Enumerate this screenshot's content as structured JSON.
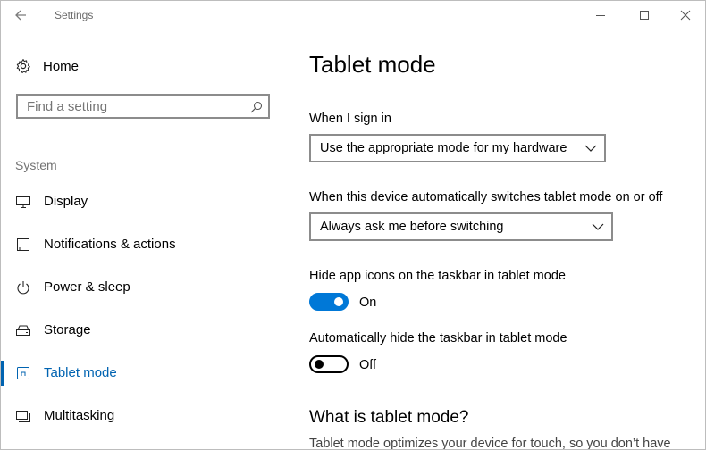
{
  "window": {
    "title": "Settings"
  },
  "sidebar": {
    "home_label": "Home",
    "search_placeholder": "Find a setting",
    "section_label": "System",
    "items": [
      {
        "label": "Display",
        "icon": "monitor-icon"
      },
      {
        "label": "Notifications & actions",
        "icon": "notification-icon"
      },
      {
        "label": "Power & sleep",
        "icon": "power-icon"
      },
      {
        "label": "Storage",
        "icon": "storage-icon"
      },
      {
        "label": "Tablet mode",
        "icon": "tablet-icon",
        "active": true
      },
      {
        "label": "Multitasking",
        "icon": "multitasking-icon"
      }
    ]
  },
  "main": {
    "title": "Tablet mode",
    "sign_in": {
      "label": "When I sign in",
      "value": "Use the appropriate mode for my hardware"
    },
    "auto_switch": {
      "label": "When this device automatically switches tablet mode on or off",
      "value": "Always ask me before switching"
    },
    "hide_icons": {
      "label": "Hide app icons on the taskbar in tablet mode",
      "state": "On"
    },
    "hide_taskbar": {
      "label": "Automatically hide the taskbar in tablet mode",
      "state": "Off"
    },
    "info_heading": "What is tablet mode?",
    "info_text": "Tablet mode optimizes your device for touch, so you don’t have"
  },
  "colors": {
    "accent": "#0078d7",
    "active_text": "#0063b1"
  }
}
